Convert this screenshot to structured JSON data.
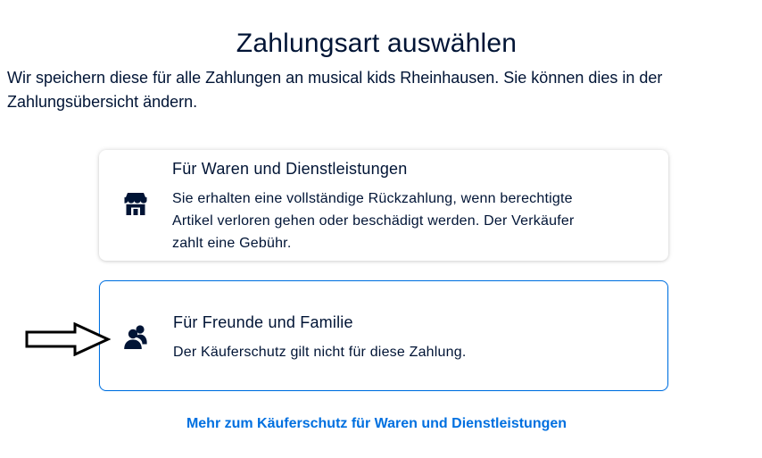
{
  "page": {
    "title": "Zahlungsart auswählen",
    "intro": "Wir speichern diese für alle Zahlungen an musical kids Rheinhausen. Sie können dies in der Zahlungsübersicht ändern."
  },
  "options": [
    {
      "icon": "store-icon",
      "title": "Für Waren und Dienstleistungen",
      "description": "Sie erhalten eine vollständige Rückzahlung, wenn berechtigte Artikel verloren gehen oder beschädigt werden. Der Verkäufer zahlt eine Gebühr.",
      "selected": false
    },
    {
      "icon": "people-icon",
      "title": "Für Freunde und Familie",
      "description": "Der Käuferschutz gilt nicht für diese Zahlung.",
      "selected": true
    }
  ],
  "annotation": {
    "icon": "arrow-right-icon"
  },
  "footer": {
    "link": "Mehr zum Käuferschutz für Waren und Dienstleistungen"
  },
  "colors": {
    "text": "#001435",
    "accent": "#0070e0",
    "selected_border": "#0070e0"
  }
}
